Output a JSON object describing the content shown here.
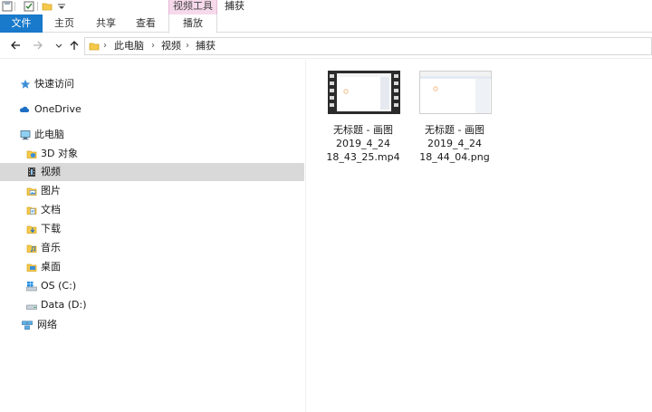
{
  "titlebar": {
    "context_tab_group": "视频工具",
    "window_title": "捕获",
    "quick_access_icons": [
      "save-icon",
      "properties-icon",
      "new-folder-icon",
      "customize-chevron-icon"
    ]
  },
  "ribbon": {
    "tabs": [
      {
        "label": "文件"
      },
      {
        "label": "主页"
      },
      {
        "label": "共享"
      },
      {
        "label": "查看"
      },
      {
        "label": "播放"
      }
    ],
    "file_tab_color": "#1979ca",
    "context_color": "#f7d9ec"
  },
  "address": {
    "breadcrumb": [
      "此电脑",
      "视频",
      "捕获"
    ],
    "separator": "›"
  },
  "navigation": {
    "items": [
      {
        "label": "快速访问",
        "icon": "star-icon"
      },
      {
        "label": "OneDrive",
        "icon": "cloud-icon"
      },
      {
        "label": "此电脑",
        "icon": "computer-icon"
      },
      {
        "label": "3D 对象",
        "icon": "3d-objects-icon"
      },
      {
        "label": "视频",
        "icon": "video-folder-icon",
        "selected": true
      },
      {
        "label": "图片",
        "icon": "pictures-folder-icon"
      },
      {
        "label": "文档",
        "icon": "documents-folder-icon"
      },
      {
        "label": "下载",
        "icon": "downloads-folder-icon"
      },
      {
        "label": "音乐",
        "icon": "music-folder-icon"
      },
      {
        "label": "桌面",
        "icon": "desktop-folder-icon"
      },
      {
        "label": "OS (C:)",
        "icon": "windows-drive-icon"
      },
      {
        "label": "Data (D:)",
        "icon": "drive-icon"
      },
      {
        "label": "网络",
        "icon": "network-icon"
      }
    ]
  },
  "files": [
    {
      "name": "无标题 - 画图\n2019_4_24\n18_43_25.mp4",
      "type": "video"
    },
    {
      "name": "无标题 - 画图\n2019_4_24\n18_44_04.png",
      "type": "image"
    }
  ]
}
